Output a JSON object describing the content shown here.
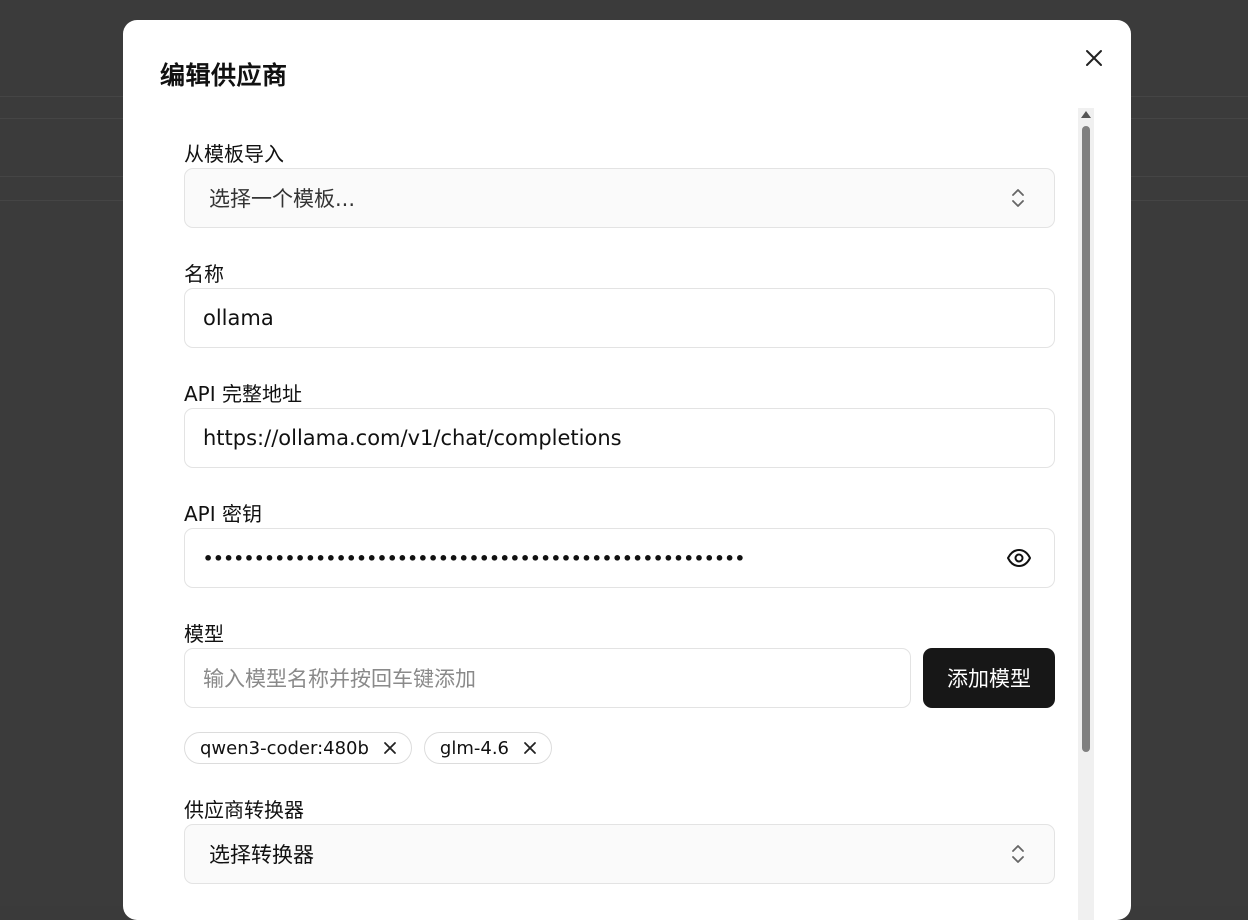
{
  "dialog": {
    "title": "编辑供应商",
    "close_icon": "close-icon"
  },
  "form": {
    "template": {
      "label": "从模板导入",
      "value": "选择一个模板..."
    },
    "name": {
      "label": "名称",
      "value": "ollama"
    },
    "api_url": {
      "label": "API 完整地址",
      "value": "https://ollama.com/v1/chat/completions"
    },
    "api_key": {
      "label": "API 密钥",
      "value": "•••••••••••••••••••••••••••••••••••••••••••••••••••••"
    },
    "models": {
      "label": "模型",
      "placeholder": "输入模型名称并按回车键添加",
      "add_button": "添加模型",
      "items": [
        "qwen3-coder:480b",
        "glm-4.6"
      ]
    },
    "transformer": {
      "label": "供应商转换器",
      "value": "选择转换器"
    }
  }
}
